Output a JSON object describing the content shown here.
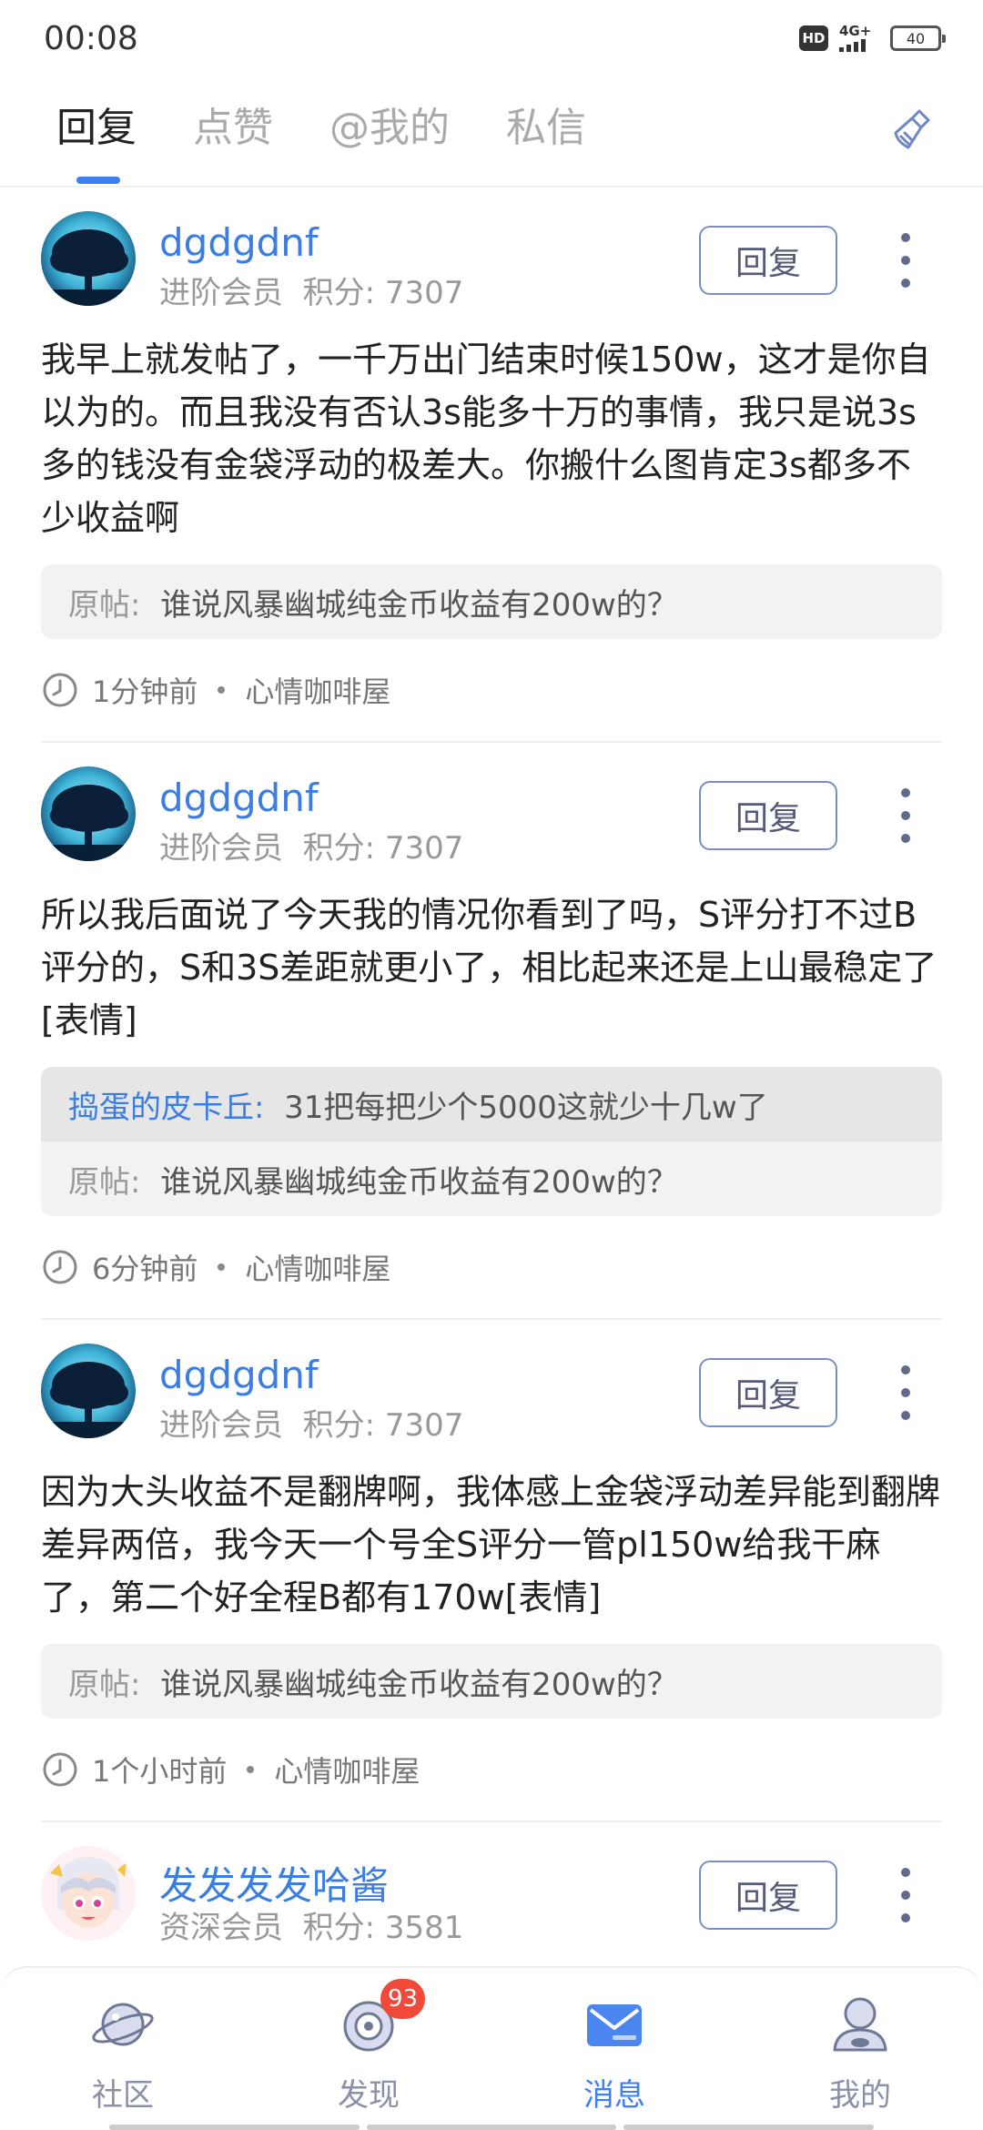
{
  "status_bar": {
    "time": "00:08",
    "hd": "HD",
    "network": "4G+",
    "battery": "40"
  },
  "tabs": [
    {
      "label": "回复",
      "active": true
    },
    {
      "label": "点赞",
      "active": false
    },
    {
      "label": "@我的",
      "active": false
    },
    {
      "label": "私信",
      "active": false
    }
  ],
  "clean_icon": "broom-icon",
  "posts": [
    {
      "username": "dgdgdnf",
      "level": "进阶会员",
      "points_label": "积分: 7307",
      "reply_label": "回复",
      "content": "我早上就发帖了，一千万出门结束时候150w，这才是你自以为的。而且我没有否认3s能多十万的事情，我只是说3s多的钱没有金袋浮动的极差大。你搬什么图肯定3s都多不少收益啊",
      "original_label": "原帖:",
      "original_title": "谁说风暴幽城纯金币收益有200w的？",
      "time": "1分钟前",
      "forum": "心情咖啡屋"
    },
    {
      "username": "dgdgdnf",
      "level": "进阶会员",
      "points_label": "积分: 7307",
      "reply_label": "回复",
      "content": "所以我后面说了今天我的情况你看到了吗，S评分打不过B评分的，S和3S差距就更小了，相比起来还是上山最稳定了[表情]",
      "reply_to_label": "捣蛋的皮卡丘:",
      "reply_to_text": "31把每把少个5000这就少十几w了",
      "original_label": "原帖:",
      "original_title": "谁说风暴幽城纯金币收益有200w的？",
      "time": "6分钟前",
      "forum": "心情咖啡屋"
    },
    {
      "username": "dgdgdnf",
      "level": "进阶会员",
      "points_label": "积分: 7307",
      "reply_label": "回复",
      "content": "因为大头收益不是翻牌啊，我体感上金袋浮动差异能到翻牌差异两倍，我今天一个号全S评分一管pl150w给我干麻了，第二个好全程B都有170w[表情]",
      "original_label": "原帖:",
      "original_title": "谁说风暴幽城纯金币收益有200w的？",
      "time": "1个小时前",
      "forum": "心情咖啡屋"
    },
    {
      "username": "发发发发哈酱",
      "level": "资深会员",
      "points_label": "积分: 3581",
      "reply_label": "回复"
    }
  ],
  "bottom_nav": [
    {
      "label": "社区",
      "icon": "planet-icon",
      "active": false
    },
    {
      "label": "发现",
      "icon": "target-icon",
      "active": false,
      "badge": "93"
    },
    {
      "label": "消息",
      "icon": "mail-icon",
      "active": true
    },
    {
      "label": "我的",
      "icon": "profile-icon",
      "active": false
    }
  ],
  "colors": {
    "accent": "#3f7ff2",
    "username": "#3b7de0",
    "badge": "#f24a3a"
  }
}
